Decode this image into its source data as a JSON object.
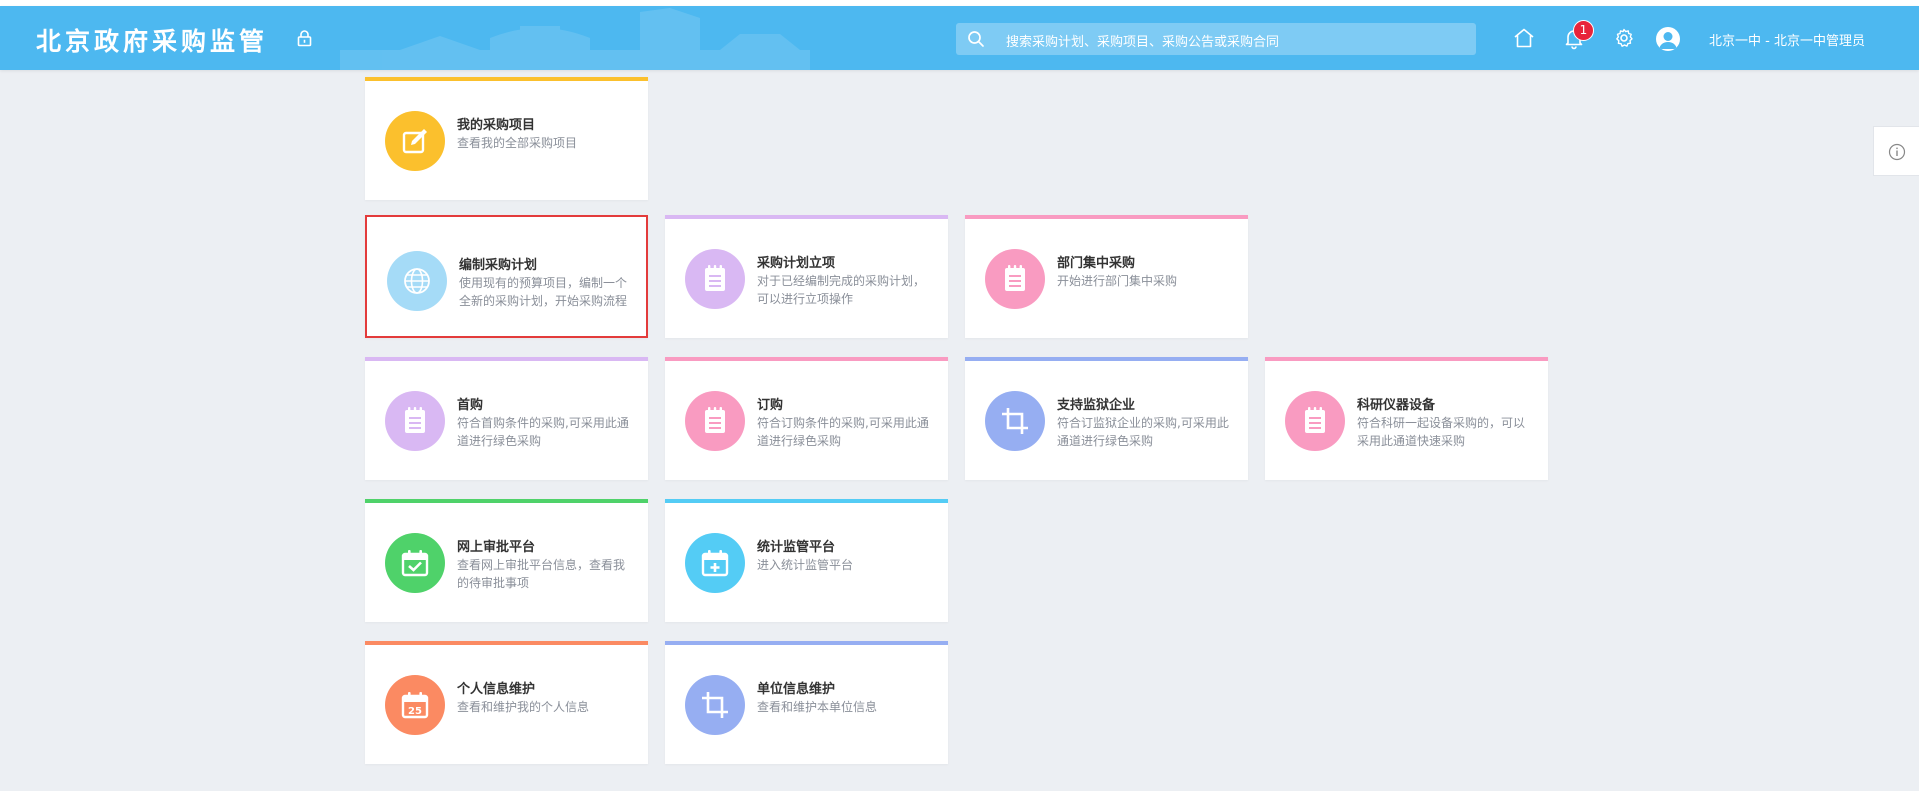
{
  "header": {
    "logo": "北京政府采购监管",
    "search_placeholder": "搜索采购计划、采购项目、采购公告或采购合同",
    "notification_count": "1",
    "user_label": "北京一中 - 北京一中管理员"
  },
  "cards": [
    {
      "title": "我的采购项目",
      "desc": "查看我的全部采购项目",
      "color": "#fbc02d",
      "icon": "edit-icon"
    },
    {
      "title": "编制采购计划",
      "desc": "使用现有的预算项目，编制一个全新的采购计划，开始采购流程",
      "color": "#a5dbf7",
      "icon": "globe-icon",
      "selected": true
    },
    {
      "title": "采购计划立项",
      "desc": "对于已经编制完成的采购计划，可以进行立项操作",
      "color": "#d9b8f3",
      "icon": "notepad-icon"
    },
    {
      "title": "部门集中采购",
      "desc": "开始进行部门集中采购",
      "color": "#f99bc1",
      "icon": "notepad-icon"
    },
    {
      "title": "首购",
      "desc": "符合首购条件的采购,可采用此通道进行绿色采购",
      "color": "#d9b8f3",
      "icon": "notepad-icon"
    },
    {
      "title": "订购",
      "desc": "符合订购条件的采购,可采用此通道进行绿色采购",
      "color": "#f99bc1",
      "icon": "notepad-icon"
    },
    {
      "title": "支持监狱企业",
      "desc": "符合订监狱企业的采购,可采用此通道进行绿色采购",
      "color": "#96aef2",
      "icon": "crop-icon"
    },
    {
      "title": "科研仪器设备",
      "desc": "符合科研一起设备采购的，可以采用此通道快速采购",
      "color": "#f99bc1",
      "icon": "notepad-icon"
    },
    {
      "title": "网上审批平台",
      "desc": "查看网上审批平台信息，查看我的待审批事项",
      "color": "#4fd26a",
      "icon": "calendar-check-icon"
    },
    {
      "title": "统计监管平台",
      "desc": "进入统计监管平台",
      "color": "#54ccf5",
      "icon": "calendar-plus-icon"
    },
    {
      "title": "个人信息维护",
      "desc": "查看和维护我的个人信息",
      "color": "#fb8a62",
      "icon": "calendar-25-icon",
      "icon_text": "25"
    },
    {
      "title": "单位信息维护",
      "desc": "查看和维护本单位信息",
      "color": "#96aef2",
      "icon": "crop-icon"
    }
  ]
}
